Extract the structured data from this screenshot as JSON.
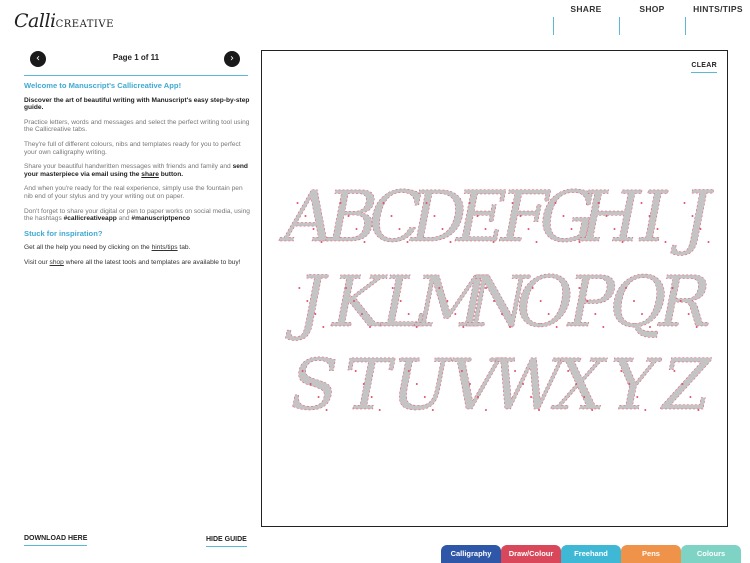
{
  "app": {
    "logo_main": "Calli",
    "logo_sub": "CREATIVE"
  },
  "nav": {
    "share": "SHARE",
    "shop": "SHOP",
    "hints": "HINTS/TIPS"
  },
  "guide": {
    "page_label": "Page 1 of 11",
    "prev_icon": "‹",
    "next_icon": "›",
    "welcome": "Welcome to Manuscript's Callicreative App!",
    "intro": "Discover the art of beautiful writing with Manuscript's easy step-by-step guide.",
    "para1": "Practice letters, words and messages and select the perfect writing tool using the Callicreative tabs.",
    "para2": "They're full of different colours, nibs and templates ready for you to perfect your own calligraphy writing.",
    "para3_a": "Share your beautiful handwritten messages with friends and family and ",
    "para3_b": "send your masterpiece via email using the ",
    "para3_c": "share",
    "para3_d": " button.",
    "para4": "And when you're ready for the real experience, simply use the fountain pen nib end of your stylus and try your writing out on paper.",
    "para5_a": "Don't forget to share your digital or pen to paper works on social media, using the hashtags ",
    "para5_b": "#callicreativeapp",
    "para5_c": " and ",
    "para5_d": "#manuscriptpenco",
    "stuck": "Stuck for inspiration?",
    "help_a": "Get all the help you need by clicking on the ",
    "help_b": "hints/tips",
    "help_c": " tab.",
    "visit_a": "Visit our ",
    "visit_b": "shop",
    "visit_c": " where all the latest tools and templates are available to buy!",
    "download": "DOWNLOAD HERE",
    "hide": "HIDE GUIDE"
  },
  "canvas": {
    "clear": "CLEAR",
    "rows": [
      [
        "A",
        "B",
        "C",
        "D",
        "E",
        "F",
        "G",
        "H",
        "I",
        "J"
      ],
      [
        "J",
        "K",
        "L",
        "M",
        "N",
        "O",
        "P",
        "Q",
        "R"
      ],
      [
        "S",
        "T",
        "U",
        "V",
        "W",
        "X",
        "Y",
        "Z"
      ]
    ],
    "letter_color": "#c4c4c4",
    "guide_color": "#e0506a"
  },
  "tabs": [
    {
      "label": "Calligraphy",
      "color": "#2f57a8"
    },
    {
      "label": "Draw/Colour",
      "color": "#d9475a"
    },
    {
      "label": "Freehand",
      "color": "#3fb8d6"
    },
    {
      "label": "Pens",
      "color": "#f0934a"
    },
    {
      "label": "Colours",
      "color": "#7fd3c4"
    }
  ]
}
